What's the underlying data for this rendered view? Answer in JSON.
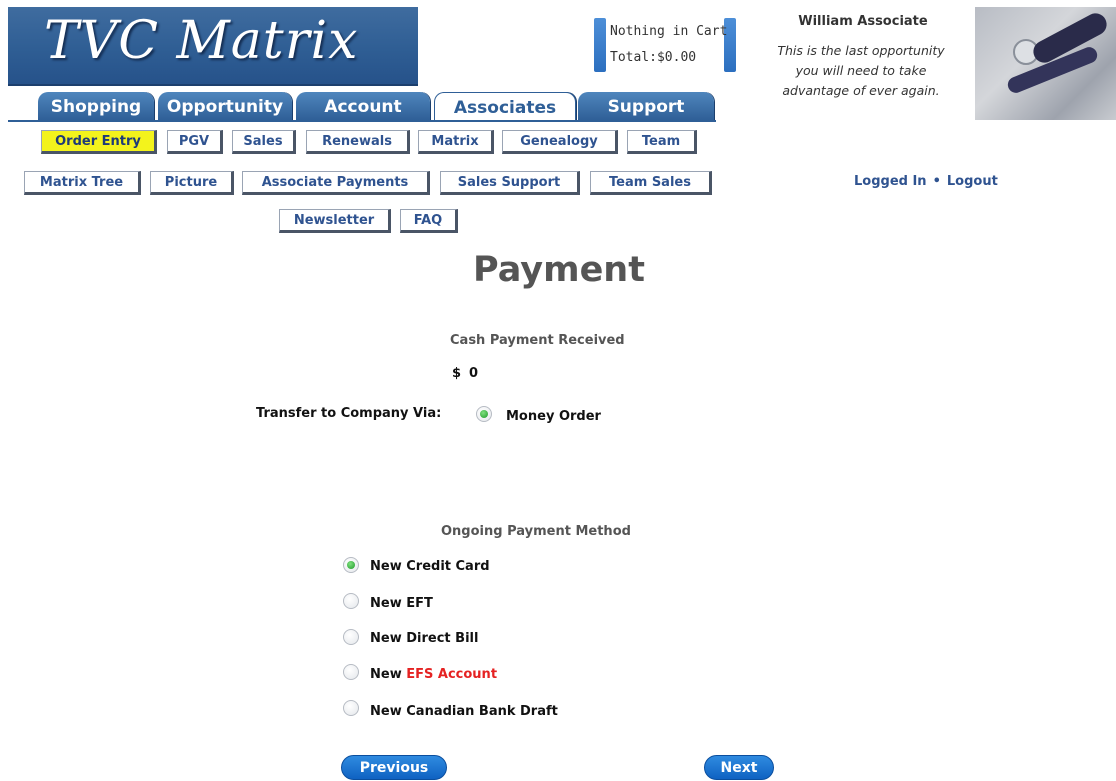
{
  "header": {
    "logo_text": "TVC Matrix",
    "cart": {
      "line1": "Nothing in Cart",
      "line2": "Total:$0.00"
    },
    "user": {
      "name": "William Associate",
      "quote_lines": [
        "This is the last opportunity",
        "you will need to take",
        "advantage of ever again."
      ]
    }
  },
  "main_tabs": [
    {
      "label": "Shopping"
    },
    {
      "label": "Opportunity"
    },
    {
      "label": "Account"
    },
    {
      "label": "Associates",
      "active": true
    },
    {
      "label": "Support"
    }
  ],
  "sub_nav": [
    {
      "label": "Order Entry",
      "active": true
    },
    {
      "label": "PGV"
    },
    {
      "label": "Sales"
    },
    {
      "label": "Renewals"
    },
    {
      "label": "Matrix"
    },
    {
      "label": "Genealogy"
    },
    {
      "label": "Team"
    },
    {
      "label": "Matrix Tree"
    },
    {
      "label": "Picture"
    },
    {
      "label": "Associate Payments"
    },
    {
      "label": "Sales Support"
    },
    {
      "label": "Team Sales"
    },
    {
      "label": "Newsletter"
    },
    {
      "label": "FAQ"
    }
  ],
  "session": {
    "status": "Logged In",
    "separator": "•",
    "logout": "Logout"
  },
  "page": {
    "title": "Payment",
    "cash": {
      "label": "Cash Payment Received",
      "currency": "$",
      "amount": "0"
    },
    "transfer": {
      "label": "Transfer to Company Via:",
      "option": "Money Order",
      "checked": true
    },
    "ongoing": {
      "label": "Ongoing Payment Method",
      "options": [
        {
          "prefix": "New",
          "text": "Credit Card",
          "checked": true
        },
        {
          "prefix": "New",
          "text": "EFT",
          "checked": false
        },
        {
          "prefix": "New",
          "text": "Direct Bill",
          "checked": false
        },
        {
          "prefix": "New",
          "text": "EFS Account",
          "checked": false,
          "highlight_color": "#e52222"
        },
        {
          "prefix": "New",
          "text": "Canadian Bank Draft",
          "checked": false
        }
      ]
    },
    "buttons": {
      "previous": "Previous",
      "next": "Next"
    }
  },
  "colors": {
    "brand_blue": "#2f5f97",
    "active_sub_nav": "#f3f31c",
    "radio_checked": "#1f9a2a",
    "pill_button": "#1a72d0"
  }
}
